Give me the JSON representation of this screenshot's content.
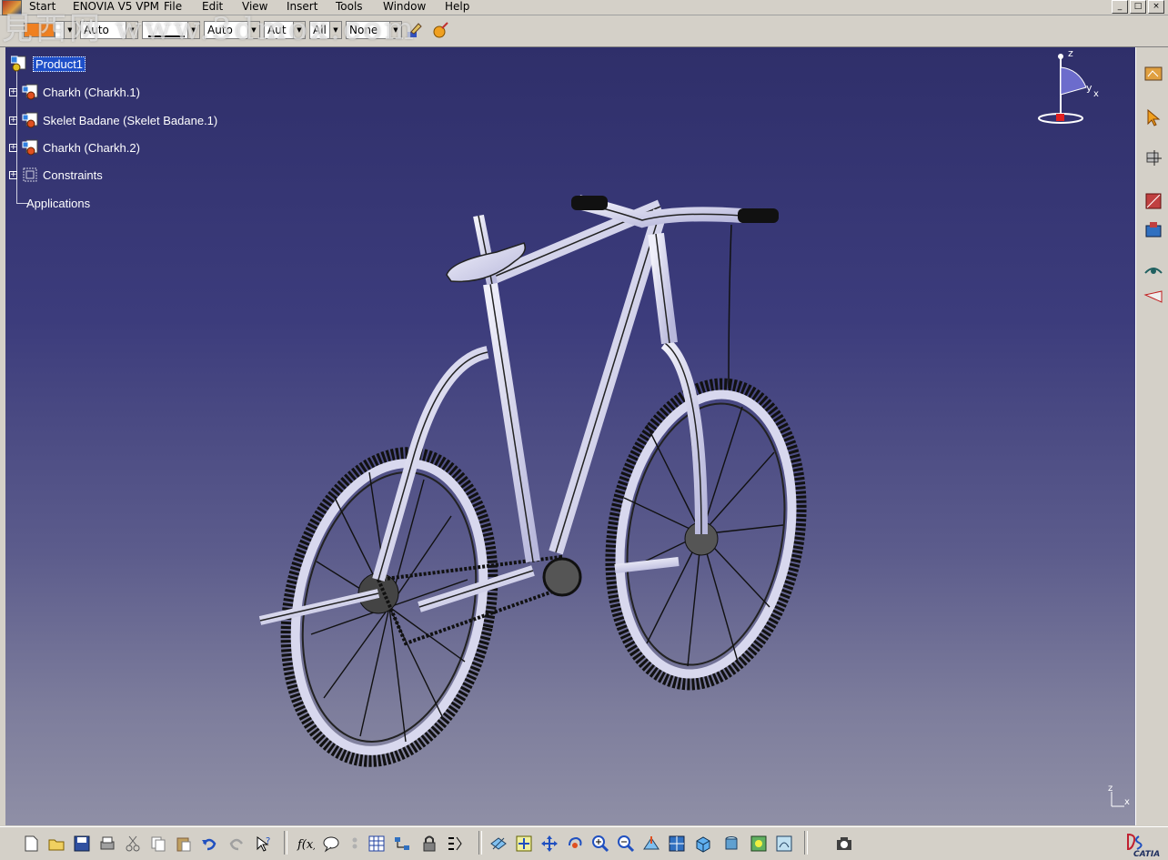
{
  "menubar": {
    "items": [
      "Start",
      "ENOVIA V5 VPM",
      "File",
      "Edit",
      "View",
      "Insert",
      "Tools",
      "Window",
      "Help"
    ]
  },
  "window_controls": [
    "_",
    "□",
    "×"
  ],
  "property_toolbar": {
    "color_swatch": "#f08020",
    "transparency": "Auto",
    "line_thickness": "Auto",
    "line_type": "Aut",
    "point_symbol": "All",
    "layer": "None"
  },
  "watermark": "見西网 www.3dmox.com",
  "spec_tree": {
    "root": "Product1",
    "children": [
      {
        "label": "Charkh (Charkh.1)",
        "icon": "part-instance-icon"
      },
      {
        "label": "Skelet Badane (Skelet Badane.1)",
        "icon": "part-instance-icon"
      },
      {
        "label": "Charkh (Charkh.2)",
        "icon": "part-instance-icon"
      },
      {
        "label": "Constraints",
        "icon": "constraints-icon"
      }
    ],
    "applications": "Applications"
  },
  "compass_axes": {
    "z": "z",
    "y": "y",
    "x": "x"
  },
  "mini_axis": {
    "z": "z",
    "x": "x"
  },
  "brand": {
    "logo_text": "CATIA"
  },
  "colors": {
    "viewport_top": "#2f2f6a",
    "viewport_bottom": "#8f8fa6",
    "selection": "#1e4fc8",
    "toolbar": "#d4d0c8"
  }
}
